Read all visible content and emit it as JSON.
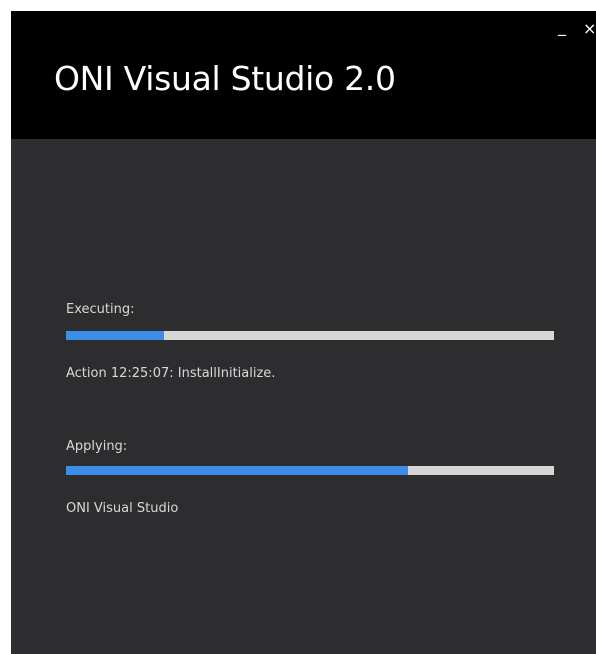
{
  "window": {
    "title": "ONI Visual Studio 2.0",
    "minimize_glyph": "_",
    "close_glyph": "×"
  },
  "progress": {
    "executing": {
      "label": "Executing:",
      "fraction": 0.2,
      "status": "Action 12:25:07: InstallInitialize."
    },
    "applying": {
      "label": "Applying:",
      "fraction": 0.7,
      "status": "ONI Visual Studio"
    }
  },
  "colors": {
    "title_bar": "#000000",
    "body": "#2d2d30",
    "progress_fill": "#3d8ee8",
    "progress_track": "#d6d6d6",
    "text": "#d8d8d8"
  }
}
